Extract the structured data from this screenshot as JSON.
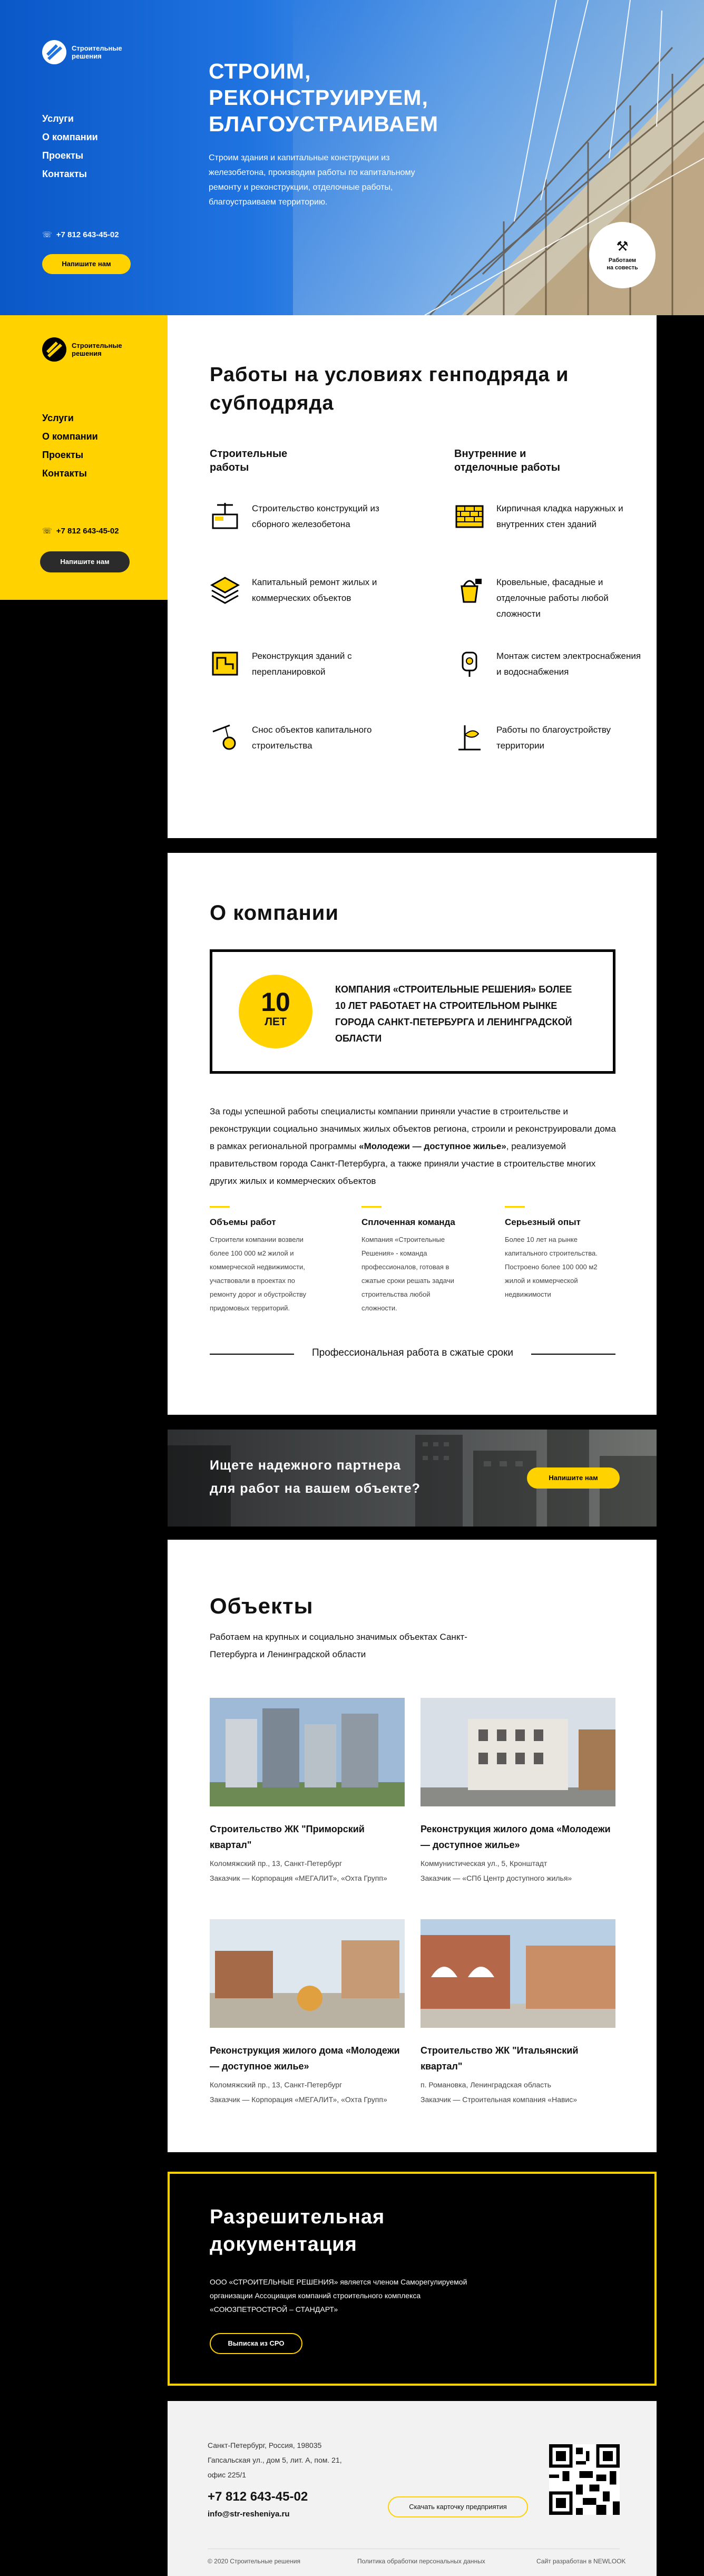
{
  "colors": {
    "accent": "#ffd200",
    "dark": "#000000",
    "hero_blue": "#1f73e0"
  },
  "brand": {
    "line1": "Строительные",
    "line2": "решения"
  },
  "nav": [
    "Услуги",
    "О компании",
    "Проекты",
    "Контакты"
  ],
  "phone": "+7 812 643-45-02",
  "write_us": "Напишите нам",
  "hero": {
    "title": "СТРОИМ, РЕКОНСТРУИРУЕМ, БЛАГОУСТРАИВАЕМ",
    "lead": "Строим здания и капитальные конструкции из железобетона, производим работы по капитальному ремонту и реконструкции, отделочные работы, благоустраиваем территорию.",
    "badge_line1": "Работаем",
    "badge_line2": "на совесть"
  },
  "works": {
    "title": "Работы на условиях генподряда и субподряда",
    "col1_title": "Строительные работы",
    "col2_title": "Внутренние и отделочные работы",
    "col1": [
      {
        "icon": "precast-concrete-icon",
        "label": "Строительство конструкций из сборного железобетона"
      },
      {
        "icon": "renovation-icon",
        "label": "Капитальный ремонт жилых и коммерческих объектов"
      },
      {
        "icon": "blueprint-icon",
        "label": "Реконструкция зданий с перепланировкой"
      },
      {
        "icon": "demolition-icon",
        "label": "Снос объектов капитального строительства"
      }
    ],
    "col2": [
      {
        "icon": "brick-wall-icon",
        "label": "Кирпичная кладка наружных и внутренних стен зданий"
      },
      {
        "icon": "paint-bucket-icon",
        "label": "Кровельные, фасадные и отделочные работы любой сложности"
      },
      {
        "icon": "electrical-icon",
        "label": "Монтаж систем электроснабжения и водоснабжения"
      },
      {
        "icon": "landscaping-icon",
        "label": "Работы по благоустройству территории"
      }
    ]
  },
  "about": {
    "title": "О компании",
    "years_number": "10",
    "years_label": "ЛЕТ",
    "highlight": "КОМПАНИЯ «СТРОИТЕЛЬНЫЕ РЕШЕНИЯ» БОЛЕЕ 10 ЛЕТ РАБОТАЕТ НА СТРОИТЕЛЬНОМ РЫНКЕ ГОРОДА САНКТ-ПЕТЕРБУРГА И ЛЕНИНГРАДСКОЙ ОБЛАСТИ",
    "para_a": "За годы успешной работы специалисты компании приняли участие в строительстве и реконструкции социально значимых жилых объектов региона, строили и реконструировали дома в рамках региональной программы ",
    "para_b": "«Молодежи — доступное жилье»",
    "para_c": ", реализуемой правительством города Санкт-Петербурга, а также приняли участие в строительстве многих других жилых и коммерческих объектов",
    "features": [
      {
        "title": "Объемы работ",
        "text": "Строители компании возвели более 100 000 м2 жилой и коммерческой недвижимости, участвовали в проектах по ремонту дорог и обустройству придомовых территорий."
      },
      {
        "title": "Сплоченная команда",
        "text": "Компания «Строительные Решения» - команда профессионалов, готовая в сжатые сроки решать задачи строительства любой сложности."
      },
      {
        "title": "Серьезный опыт",
        "text": "Более 10 лет на рынке капитального строительства. Построено более 100 000 м2 жилой и коммерческой недвижимости"
      }
    ],
    "tagline": "Профессиональная работа в сжатые сроки"
  },
  "cta": {
    "line1": "Ищете надежного партнера",
    "line2": "для работ на вашем объекте?",
    "button": "Напишите нам"
  },
  "objects": {
    "title": "Объекты",
    "subtitle": "Работаем на крупных и социально значимых объектах Санкт-Петербурга и Ленинградской области",
    "items": [
      {
        "name": "Строительство ЖК \"Приморский квартал\"",
        "address": "Коломяжский пр., 13, Санкт-Петербург",
        "client": "Заказчик — Корпорация «МЕГАЛИТ», «Охта Групп»"
      },
      {
        "name": "Реконструкция жилого дома «Молодежи — доступное жилье»",
        "address": "Коммунистическая ул., 5, Кронштадт",
        "client": "Заказчик — «СПб Центр доступного жилья»"
      },
      {
        "name": "Реконструкция жилого дома «Молодежи — доступное жилье»",
        "address": "Коломяжский пр., 13, Санкт-Петербург",
        "client": "Заказчик — Корпорация «МЕГАЛИТ», «Охта Групп»"
      },
      {
        "name": "Строительство ЖК \"Итальянский квартал\"",
        "address": "п. Романовка, Ленинградская область",
        "client": "Заказчик — Строительная компания «Навис»"
      }
    ]
  },
  "permits": {
    "title": "Разрешительная документация",
    "text": "ООО «СТРОИТЕЛЬНЫЕ РЕШЕНИЯ» является членом Саморегулируемой организации Ассоциация компаний строительного комплекса «СОЮЗПЕТРОСТРОЙ – СТАНДАРТ»",
    "button": "Выписка из СРО"
  },
  "footer": {
    "address_line1": "Санкт-Петербург, Россия, 198035",
    "address_line2": "Гапсальская ул., дом 5, лит. А, пом. 21,",
    "address_line3": "офис 225/1",
    "phone": "+7 812 643-45-02",
    "email": "info@str-resheniya.ru",
    "card_button": "Скачать карточку предприятия",
    "copyright": "© 2020 Строительные решения",
    "policy": "Политика обработки персональных данных",
    "dev": "Сайт разработан в NEWLOOK"
  }
}
